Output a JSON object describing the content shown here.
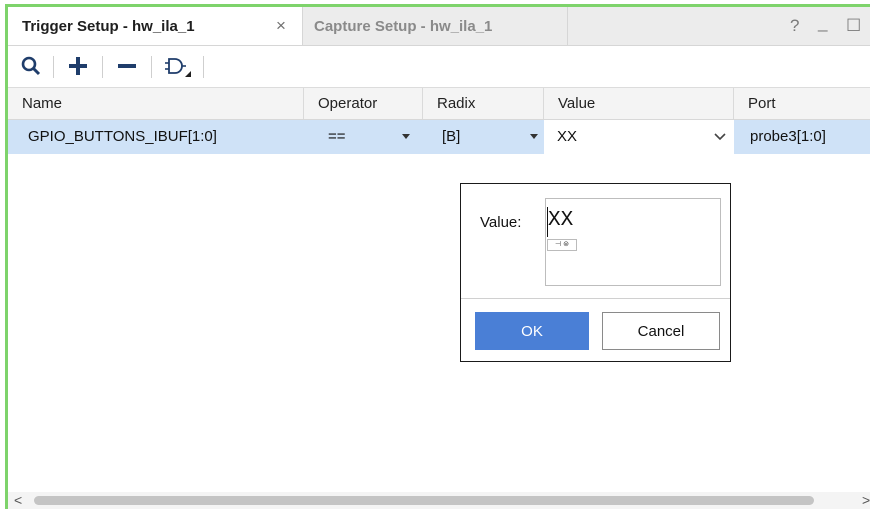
{
  "tabs": [
    {
      "label": "Trigger Setup - hw_ila_1",
      "close": "×",
      "active": true
    },
    {
      "label": "Capture Setup - hw_ila_1",
      "active": false
    }
  ],
  "window_controls": {
    "help": "?",
    "minimize": "_",
    "maximize": "☐"
  },
  "toolbar": {
    "icons": [
      "search-icon",
      "plus-icon",
      "minus-icon",
      "logic-gate-icon"
    ]
  },
  "table": {
    "columns": [
      "Name",
      "Operator",
      "Radix",
      "Value",
      "Port"
    ],
    "rows": [
      {
        "name": "GPIO_BUTTONS_IBUF[1:0]",
        "operator": "==",
        "radix": "[B]",
        "value": "XX",
        "port": "probe3[1:0]"
      }
    ]
  },
  "popup": {
    "label": "Value:",
    "value": "XX",
    "ok": "OK",
    "cancel": "Cancel"
  },
  "scrollbar": {
    "left_arrow": "<",
    "right_arrow": ">"
  },
  "colors": {
    "accent_border": "#7ed36b",
    "selection_row": "#cfe2f7",
    "ok_button": "#4a7fd6"
  }
}
